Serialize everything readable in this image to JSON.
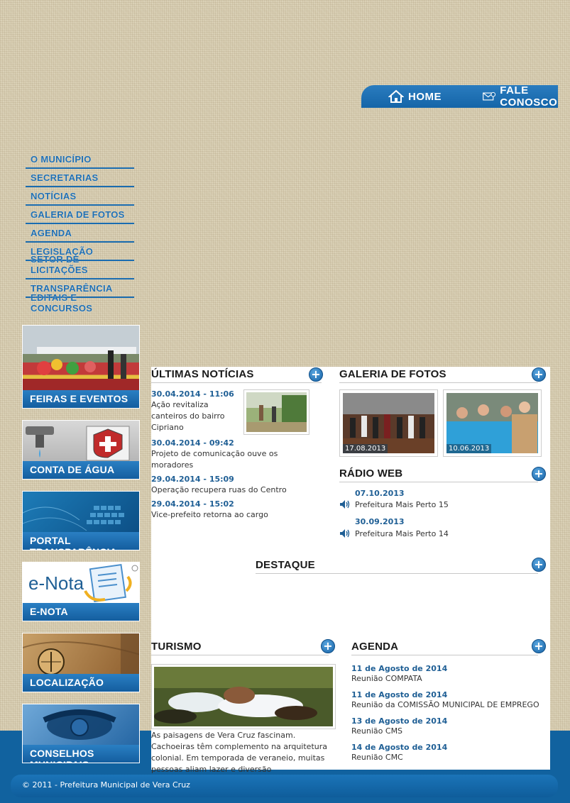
{
  "header": {
    "nav": [
      {
        "label": "HOME",
        "icon": "house-icon"
      },
      {
        "label": "FALE CONOSCO",
        "icon": "mail-icon"
      }
    ]
  },
  "sidebar": {
    "menu": [
      {
        "label": "O Município"
      },
      {
        "label": "Secretarias"
      },
      {
        "label": "Notícias"
      },
      {
        "label": "Galeria de Fotos"
      },
      {
        "label": "Agenda"
      },
      {
        "label": "Legislação"
      },
      {
        "label": "Setor de Licitações"
      },
      {
        "label": "Transparência"
      },
      {
        "label": "Editais e Concursos"
      }
    ],
    "banners": [
      {
        "label": "FEIRAS E EVENTOS"
      },
      {
        "label": "CONTA DE ÁGUA"
      },
      {
        "label": "PORTAL TRANSPARÊNCIA"
      },
      {
        "label": "E-NOTA",
        "image_text": "e-Nota"
      },
      {
        "label": "LOCALIZAÇÃO"
      },
      {
        "label": "CONSELHOS MUNICIPAIS"
      }
    ]
  },
  "news": {
    "title": "ÚLTIMAS NOTÍCIAS",
    "items": [
      {
        "date": "30.04.2014 - 11:06",
        "text_lines": [
          "Ação revitaliza",
          "canteiros do bairro",
          "Cipriano"
        ]
      },
      {
        "date": "30.04.2014 - 09:42",
        "text_lines": [
          "Projeto de comunicação ouve os",
          "moradores"
        ]
      },
      {
        "date": "29.04.2014 - 15:09",
        "text_lines": [
          "Operação recupera ruas do Centro"
        ]
      },
      {
        "date": "29.04.2014 - 15:02",
        "text_lines": [
          "Vice-prefeito retorna ao cargo"
        ]
      }
    ]
  },
  "gallery": {
    "title": "GALERIA DE FOTOS",
    "photos": [
      {
        "date": "17.08.2013"
      },
      {
        "date": "10.06.2013"
      }
    ]
  },
  "radio": {
    "title": "RÁDIO WEB",
    "items": [
      {
        "date": "07.10.2013",
        "text": "Prefeitura Mais Perto 15"
      },
      {
        "date": "30.09.2013",
        "text": "Prefeitura Mais Perto 14"
      }
    ]
  },
  "destaque": {
    "title": "DESTAQUE"
  },
  "tourism": {
    "title": "TURISMO",
    "text_lines": [
      "As paisagens de Vera Cruz fascinam.",
      "Cachoeiras têm complemento na arquitetura",
      "colonial. Em temporada de veraneio, muitas",
      "pessoas aliam lazer e diversão"
    ]
  },
  "agenda": {
    "title": "AGENDA",
    "items": [
      {
        "date": "11 de Agosto de 2014",
        "text": "Reunião COMPATA"
      },
      {
        "date": "11 de Agosto de 2014",
        "text": "Reunião da COMISSÃO MUNICIPAL DE EMPREGO"
      },
      {
        "date": "13 de Agosto de 2014",
        "text": "Reunião CMS"
      },
      {
        "date": "14 de Agosto de 2014",
        "text": "Reunião CMC"
      }
    ]
  },
  "footer": {
    "text": "© 2011 - Prefeitura Municipal de Vera Cruz"
  },
  "plus_label": "+",
  "colors": {
    "brand_blue": "#1a6cb0",
    "link_blue": "#1f5f95",
    "footer_blue": "#11629f"
  }
}
